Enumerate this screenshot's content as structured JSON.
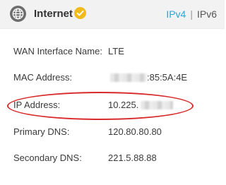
{
  "header": {
    "title": "Internet",
    "icon": "globe-icon",
    "status_icon": "check-circle-icon",
    "status_color": "#f2bb1c",
    "tabs": [
      {
        "label": "IPv4",
        "active": true
      },
      {
        "label": "IPv6",
        "active": false
      }
    ],
    "tab_separator": "|",
    "accent_color": "#2aa5d4"
  },
  "details": {
    "wan_interface": {
      "label": "WAN Interface Name:",
      "value": "LTE"
    },
    "mac_address": {
      "label": "MAC Address:",
      "value": ":85:5A:4E"
    },
    "ip_address": {
      "label": "IP Address:",
      "value": "10.225."
    },
    "primary_dns": {
      "label": "Primary DNS:",
      "value": "120.80.80.80"
    },
    "secondary_dns": {
      "label": "Secondary DNS:",
      "value": "221.5.88.88"
    }
  },
  "highlight_color": "#d82a2a"
}
